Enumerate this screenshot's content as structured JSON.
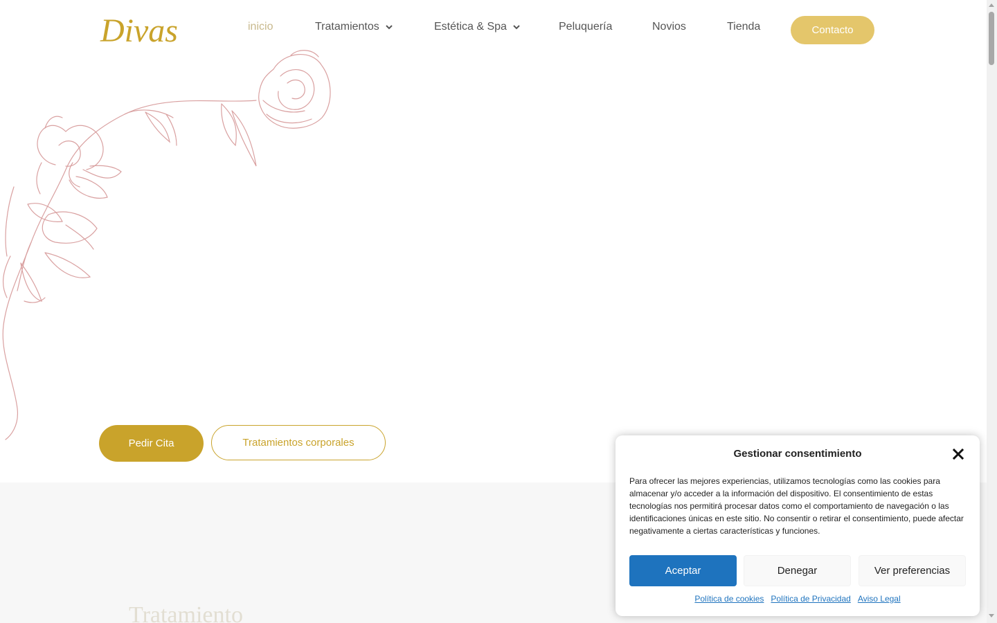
{
  "brand": {
    "logo_text": "Divas",
    "logo_color": "#c9a32b"
  },
  "nav": {
    "items": [
      {
        "label": "inicio",
        "active": true,
        "has_dropdown": false
      },
      {
        "label": "Tratamientos",
        "active": false,
        "has_dropdown": true
      },
      {
        "label": "Estética & Spa",
        "active": false,
        "has_dropdown": true
      },
      {
        "label": "Peluquería",
        "active": false,
        "has_dropdown": false
      },
      {
        "label": "Novios",
        "active": false,
        "has_dropdown": false
      },
      {
        "label": "Tienda",
        "active": false,
        "has_dropdown": false
      }
    ],
    "contact_label": "Contacto",
    "contact_color": "#e4c66b"
  },
  "hero": {
    "primary_button": "Pedir Cita",
    "secondary_button": "Tratamientos corporales",
    "accent_color": "#c9a32b",
    "floral_color": "#d9a0a0"
  },
  "section": {
    "heading": "Tratamiento"
  },
  "cookie": {
    "title": "Gestionar consentimiento",
    "text": "Para ofrecer las mejores experiencias, utilizamos tecnologías como las cookies para almacenar y/o acceder a la información del dispositivo. El consentimiento de estas tecnologías nos permitirá procesar datos como el comportamiento de navegación o las identificaciones únicas en este sitio. No consentir o retirar el consentimiento, puede afectar negativamente a ciertas características y funciones.",
    "accept_label": "Aceptar",
    "deny_label": "Denegar",
    "prefs_label": "Ver preferencias",
    "links": [
      "Política de cookies",
      "Política de Privacidad",
      "Aviso Legal"
    ],
    "accept_color": "#1e73be"
  }
}
